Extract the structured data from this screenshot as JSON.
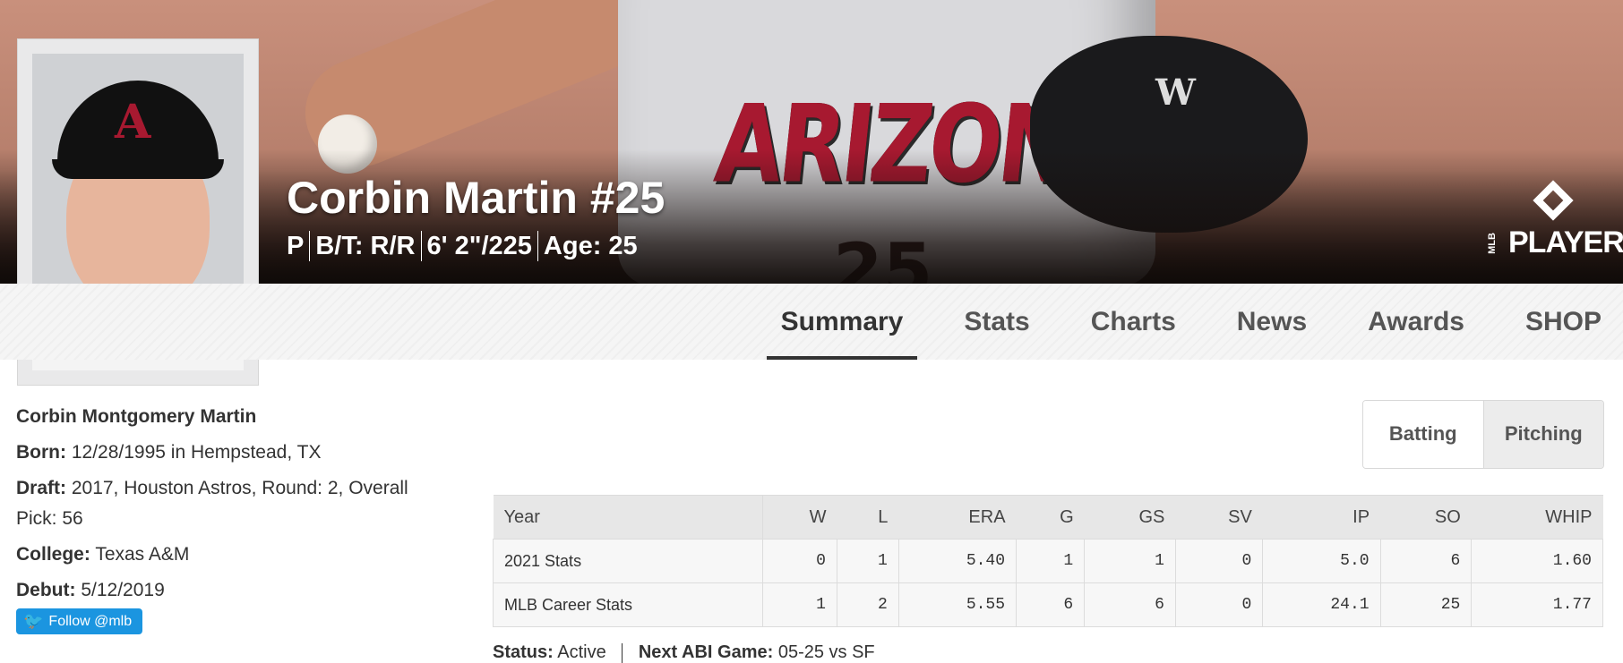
{
  "hero": {
    "name": "Corbin Martin #25",
    "position": "P",
    "bats_throws": "B/T: R/R",
    "height_weight": "6' 2\"/225",
    "age": "Age: 25",
    "logo_text": "PLAYERS",
    "logo_sub": "MLB",
    "jersey_text": "ARIZONA"
  },
  "tabs": [
    "Summary",
    "Stats",
    "Charts",
    "News",
    "Awards",
    "SHOP"
  ],
  "bio": {
    "full_name": "Corbin Montgomery Martin",
    "born_label": "Born:",
    "born_value": "12/28/1995 in Hempstead, TX",
    "draft_label": "Draft:",
    "draft_value": "2017, Houston Astros, Round: 2, Overall Pick: 56",
    "college_label": "College:",
    "college_value": "Texas A&M",
    "debut_label": "Debut:",
    "debut_value": "5/12/2019",
    "follow_label": "Follow @mlb"
  },
  "toggle": {
    "batting": "Batting",
    "pitching": "Pitching"
  },
  "stats": {
    "headers": [
      "Year",
      "W",
      "L",
      "ERA",
      "G",
      "GS",
      "SV",
      "IP",
      "SO",
      "WHIP"
    ],
    "rows": [
      [
        "2021 Stats",
        "0",
        "1",
        "5.40",
        "1",
        "1",
        "0",
        "5.0",
        "6",
        "1.60"
      ],
      [
        "MLB Career Stats",
        "1",
        "2",
        "5.55",
        "6",
        "6",
        "0",
        "24.1",
        "25",
        "1.77"
      ]
    ]
  },
  "status_line": {
    "status_label": "Status:",
    "status_value": "Active",
    "next_label": "Next ABI Game:",
    "next_value": "05-25 vs SF"
  },
  "colors": {
    "accent": "#a71930",
    "twitter": "#1b95e0",
    "hero_bg": "#c9907c"
  }
}
